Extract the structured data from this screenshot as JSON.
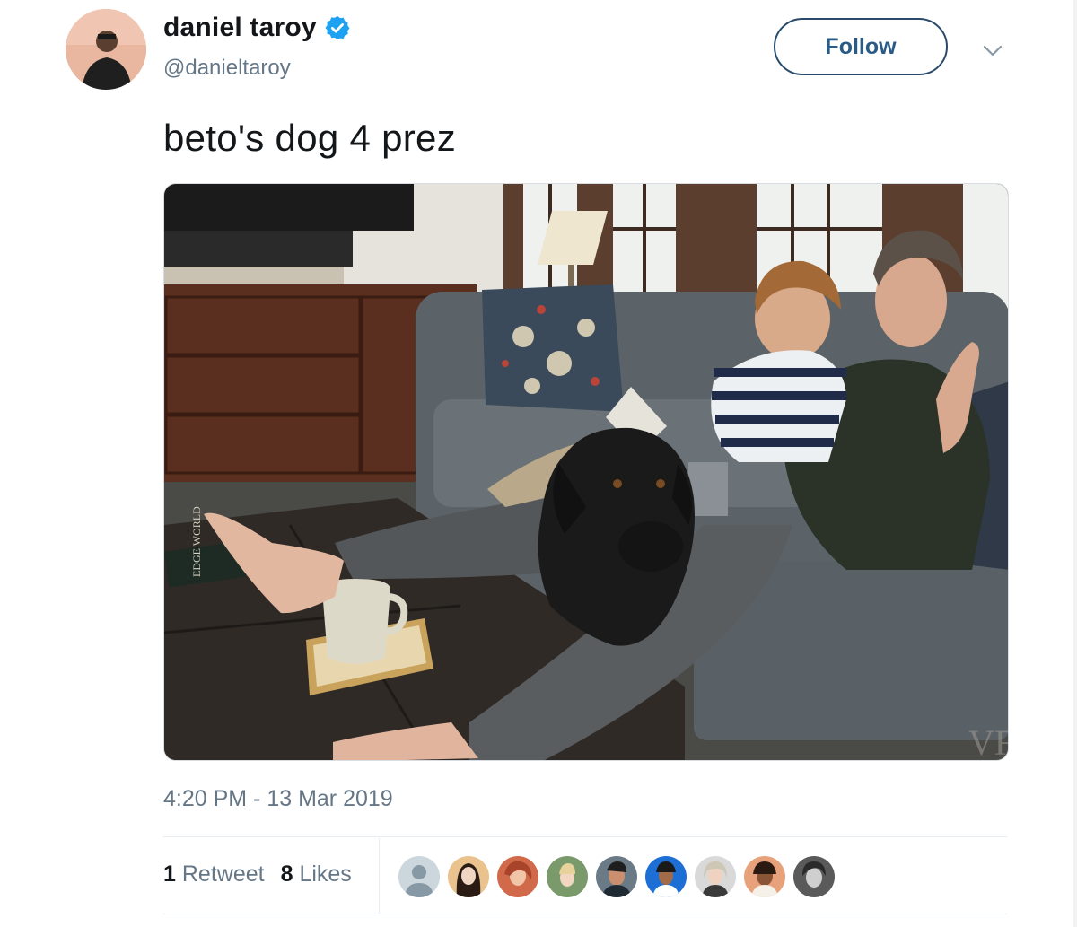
{
  "author": {
    "display_name": "daniel taroy",
    "handle": "@danieltaroy",
    "verified": true
  },
  "actions": {
    "follow_label": "Follow"
  },
  "tweet": {
    "text": "beto's dog 4 prez",
    "timestamp": "4:20 PM - 13 Mar 2019"
  },
  "stats": {
    "retweets_count": "1",
    "retweets_label": "Retweet",
    "likes_count": "8",
    "likes_label": "Likes"
  },
  "photo": {
    "watermark": "VF",
    "book_title": "EDGE WORLD"
  },
  "colors": {
    "accent": "#1da1f2",
    "secondary_text": "#657786"
  },
  "likers": [
    "default-avatar",
    "liker-2",
    "liker-3",
    "liker-4",
    "liker-5",
    "liker-6",
    "liker-7",
    "liker-8",
    "liker-9"
  ]
}
